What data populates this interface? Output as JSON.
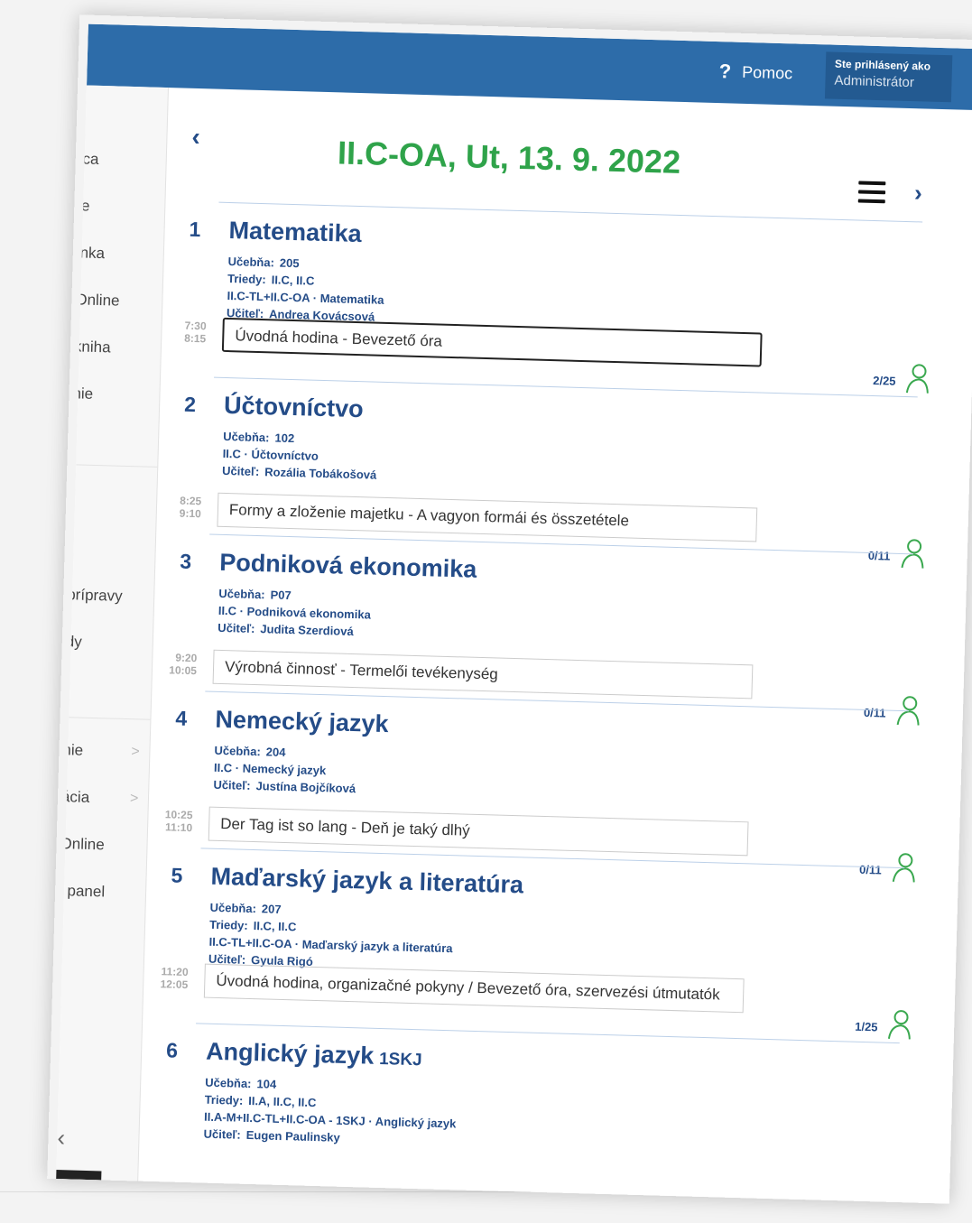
{
  "header": {
    "help_label": "Pomoc",
    "login_line1": "Ste prihlásený ako",
    "login_line2": "Administrátor"
  },
  "sidebar": {
    "items": [
      {
        "label": "lca"
      },
      {
        "label": "ie"
      },
      {
        "label": "inka"
      },
      {
        "label": "Online"
      },
      {
        "label": "kniha"
      },
      {
        "label": "nie"
      },
      {
        "label": "prípravy"
      },
      {
        "label": "dy"
      },
      {
        "label": "/"
      },
      {
        "label": "nie"
      },
      {
        "label": "ácia"
      },
      {
        "label": "Online"
      },
      {
        "label": "í panel"
      }
    ]
  },
  "page": {
    "title": "II.C-OA, Ut, 13. 9. 2022"
  },
  "labels": {
    "room": "Učebňa:",
    "classes": "Triedy:",
    "teacher": "Učiteľ:"
  },
  "lessons": [
    {
      "num": "1",
      "subject": "Matematika",
      "room": "205",
      "classes": "II.C, II.C",
      "group": "II.C-TL+II.C-OA · Matematika",
      "teacher": "Andrea Kovácsová",
      "time_start": "7:30",
      "time_end": "8:15",
      "topic": "Úvodná hodina - Bevezető óra",
      "count": "2/25"
    },
    {
      "num": "2",
      "subject": "Účtovníctvo",
      "room": "102",
      "group": "II.C · Účtovníctvo",
      "teacher": "Rozália Tobákošová",
      "time_start": "8:25",
      "time_end": "9:10",
      "topic": "Formy a zloženie majetku - A vagyon formái és összetétele",
      "count": "0/11"
    },
    {
      "num": "3",
      "subject": "Podniková ekonomika",
      "room": "P07",
      "group": "II.C · Podniková ekonomika",
      "teacher": "Judita Szerdiová",
      "time_start": "9:20",
      "time_end": "10:05",
      "topic": "Výrobná činnosť - Termelői tevékenység",
      "count": "0/11"
    },
    {
      "num": "4",
      "subject": "Nemecký jazyk",
      "room": "204",
      "group": "II.C · Nemecký jazyk",
      "teacher": "Justína Bojčíková",
      "time_start": "10:25",
      "time_end": "11:10",
      "topic": "Der Tag ist so lang - Deň je taký dlhý",
      "count": "0/11"
    },
    {
      "num": "5",
      "subject": "Maďarský jazyk a literatúra",
      "room": "207",
      "classes": "II.C, II.C",
      "group": "II.C-TL+II.C-OA · Maďarský jazyk a literatúra",
      "teacher": "Gyula Rigó",
      "time_start": "11:20",
      "time_end": "12:05",
      "topic": "Úvodná hodina, organizačné pokyny / Bevezető óra, szervezési útmutatók",
      "count": "1/25"
    },
    {
      "num": "6",
      "subject": "Anglický jazyk",
      "subject_tag": "1SKJ",
      "room": "104",
      "classes": "II.A, II.C, II.C",
      "group": "II.A-M+II.C-TL+II.C-OA - 1SKJ · Anglický jazyk",
      "teacher": "Eugen Paulinsky"
    }
  ],
  "colors": {
    "header_bg": "#2d6ca9",
    "title_green": "#2fa34a",
    "text_blue": "#244c88",
    "person_icon_green": "#3aa84f"
  }
}
